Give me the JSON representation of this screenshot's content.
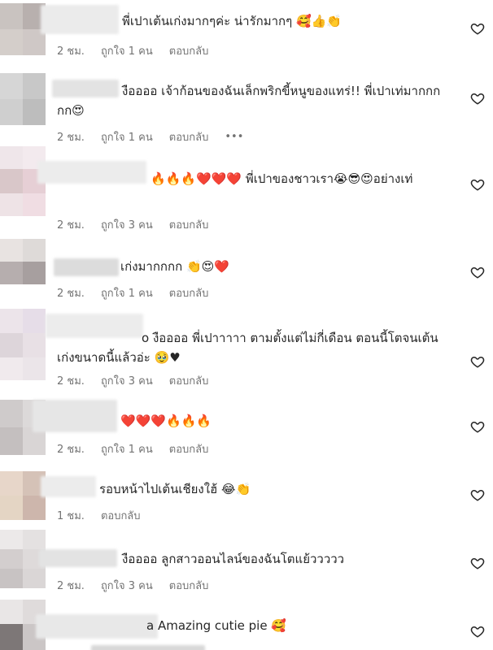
{
  "comments": [
    {
      "text": "พี่เปาเต้นเก่งมากๆค่ะ น่ารักมากๆ 🥰👍👏",
      "time": "2 ชม.",
      "likes": "ถูกใจ 1 คน",
      "reply": "ตอบกลับ",
      "more": "",
      "like_icon": "heart-outline-icon"
    },
    {
      "text": "งืออออ เจ้าก้อนของฉันเล็กพริกขี้หนูของแทร่!! พี่เปาเท่มากกกกก😍",
      "time": "2 ชม.",
      "likes": "ถูกใจ 1 คน",
      "reply": "ตอบกลับ",
      "more": "•••",
      "like_icon": "heart-outline-icon"
    },
    {
      "text": "🔥🔥🔥❤️❤️❤️ พี่เปาของชาวเรา😭😎😍อย่างเท่",
      "time": "2 ชม.",
      "likes": "ถูกใจ 3 คน",
      "reply": "ตอบกลับ",
      "more": "",
      "like_icon": "heart-outline-icon"
    },
    {
      "text": "เก่งมากกกก 👏😍❤️",
      "time": "2 ชม.",
      "likes": "ถูกใจ 1 คน",
      "reply": "ตอบกลับ",
      "more": "",
      "like_icon": "heart-outline-icon"
    },
    {
      "text": "o งืออออ พี่เปาาาาา ตามตั้งแต่ไม่กี่เดือน ตอนนี้โตจนเต้นเก่งขนาดนี้แล้วอ่ะ 🥹♥",
      "time": "2 ชม.",
      "likes": "ถูกใจ 3 คน",
      "reply": "ตอบกลับ",
      "more": "",
      "like_icon": "heart-outline-icon"
    },
    {
      "text": "❤️❤️❤️🔥🔥🔥",
      "time": "2 ชม.",
      "likes": "ถูกใจ 1 คน",
      "reply": "ตอบกลับ",
      "more": "",
      "like_icon": "heart-outline-icon"
    },
    {
      "text": "รอบหน้าไปเต้นเชียงใฮ้ 😂👏",
      "time": "1 ชม.",
      "likes": "",
      "reply": "ตอบกลับ",
      "more": "",
      "like_icon": "heart-outline-icon"
    },
    {
      "text": "งืออออ ลูกสาวออนไลน์ของฉันโตแย้ววววว",
      "time": "2 ชม.",
      "likes": "ถูกใจ 3 คน",
      "reply": "ตอบกลับ",
      "more": "",
      "like_icon": "heart-outline-icon"
    },
    {
      "text": "a Amazing cutie pie 🥰",
      "time": "",
      "likes": "",
      "reply": "",
      "more": "",
      "like_icon": "heart-outline-icon"
    }
  ],
  "colors": {
    "text": "#262626",
    "meta": "#737373",
    "background": "#ffffff"
  }
}
